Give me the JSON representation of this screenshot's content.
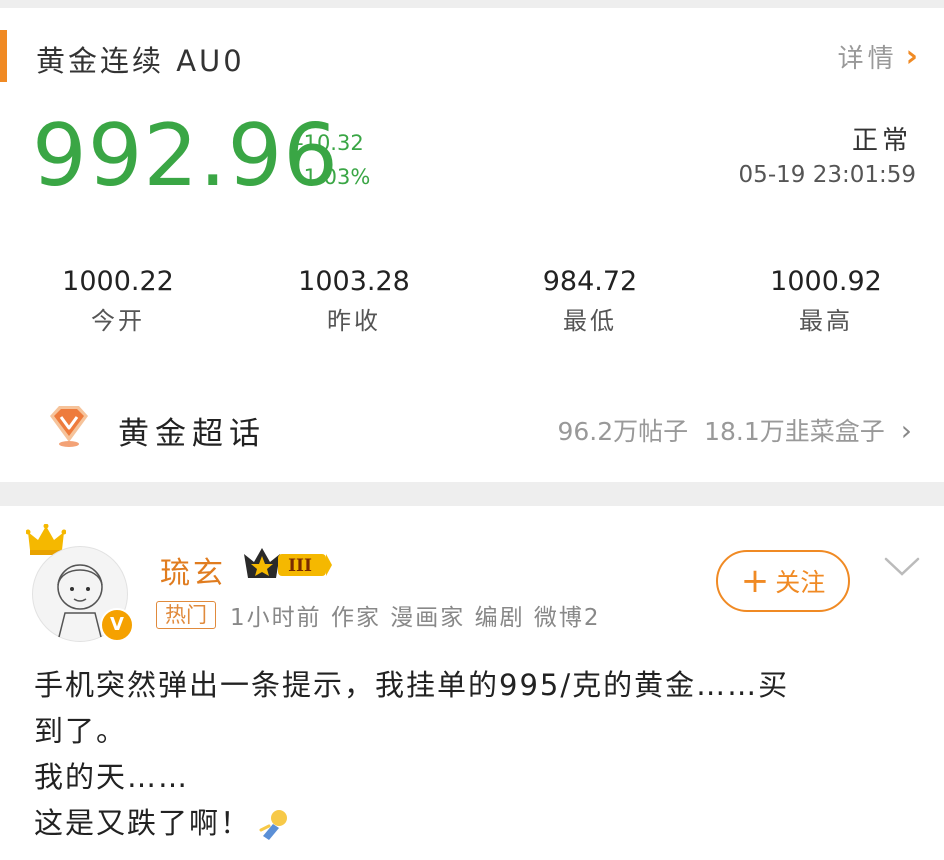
{
  "quote_card": {
    "title": "黄金连续 AU0",
    "detail_label": "详情",
    "price": "992.96",
    "change_abs": "-10.32",
    "change_pct": "-1.03%",
    "status": "正常",
    "timestamp": "05-19 23:01:59",
    "stats": [
      {
        "value": "1000.22",
        "label": "今开"
      },
      {
        "value": "1003.28",
        "label": "昨收"
      },
      {
        "value": "984.72",
        "label": "最低"
      },
      {
        "value": "1000.92",
        "label": "最高"
      }
    ],
    "colors": {
      "down": "#3aa645",
      "accent": "#f08a24"
    }
  },
  "super_topic": {
    "name": "黄金超话",
    "posts": "96.2万帖子",
    "members": "18.1万韭菜盒子"
  },
  "post": {
    "username": "琉玄",
    "level": "III",
    "hot_tag": "热门",
    "meta": "1小时前 作家 漫画家 编剧 微博2",
    "follow_label": "关注",
    "lines": [
      "手机突然弹出一条提示，我挂单的995/克的黄金……买",
      "到了。",
      "我的天……",
      "这是又跌了啊！"
    ]
  }
}
